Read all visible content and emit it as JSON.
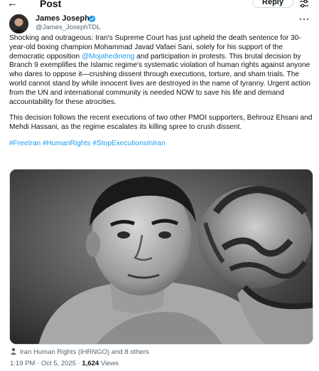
{
  "header": {
    "title": "Post",
    "reply_label": "Reply",
    "back_icon": "back-arrow-icon",
    "filter_icon": "adjust-icon"
  },
  "author": {
    "name": "James Joseph",
    "handle": "@James_JosephTDL",
    "verified": true,
    "verified_color": "#1d9bf0"
  },
  "post": {
    "p1_before_mention": "Shocking and outrageous: Iran's Supreme Court has just upheld the death sentence for 30-year-old boxing champion Mohammad Javad Vafaei Sani, solely for his support of the democratic opposition ",
    "mention": "@Mojahedineng",
    "p1_after_mention": " and participation in protests. This brutal decision by Branch 9 exemplifies the Islamic regime's systematic violation of human rights against anyone who dares to oppose it—crushing dissent through executions, torture, and sham trials. The world cannot stand by while innocent lives are destroyed in the name of tyranny. Urgent action from the UN and international community is needed NOW to save his life and demand accountability for these atrocities.",
    "p2": "This decision follows the recent executions of two other PMOI supporters, Behrouz Ehsani and Mehdi Hassani, as the regime escalates its killing spree to crush dissent.",
    "hashtags": [
      "#FreeIran",
      "#HumanRights",
      "#StopExecutionsInIran"
    ],
    "link_color": "#1d9bf0"
  },
  "media": {
    "description_icon": "photo-image"
  },
  "tagged": {
    "text": "Iran Human Rights (IHRNGO) and 8 others"
  },
  "meta": {
    "time": "1:19 PM",
    "separator": " · ",
    "date": "Oct 5, 2025",
    "views_count": "1,624",
    "views_label": "Views"
  }
}
